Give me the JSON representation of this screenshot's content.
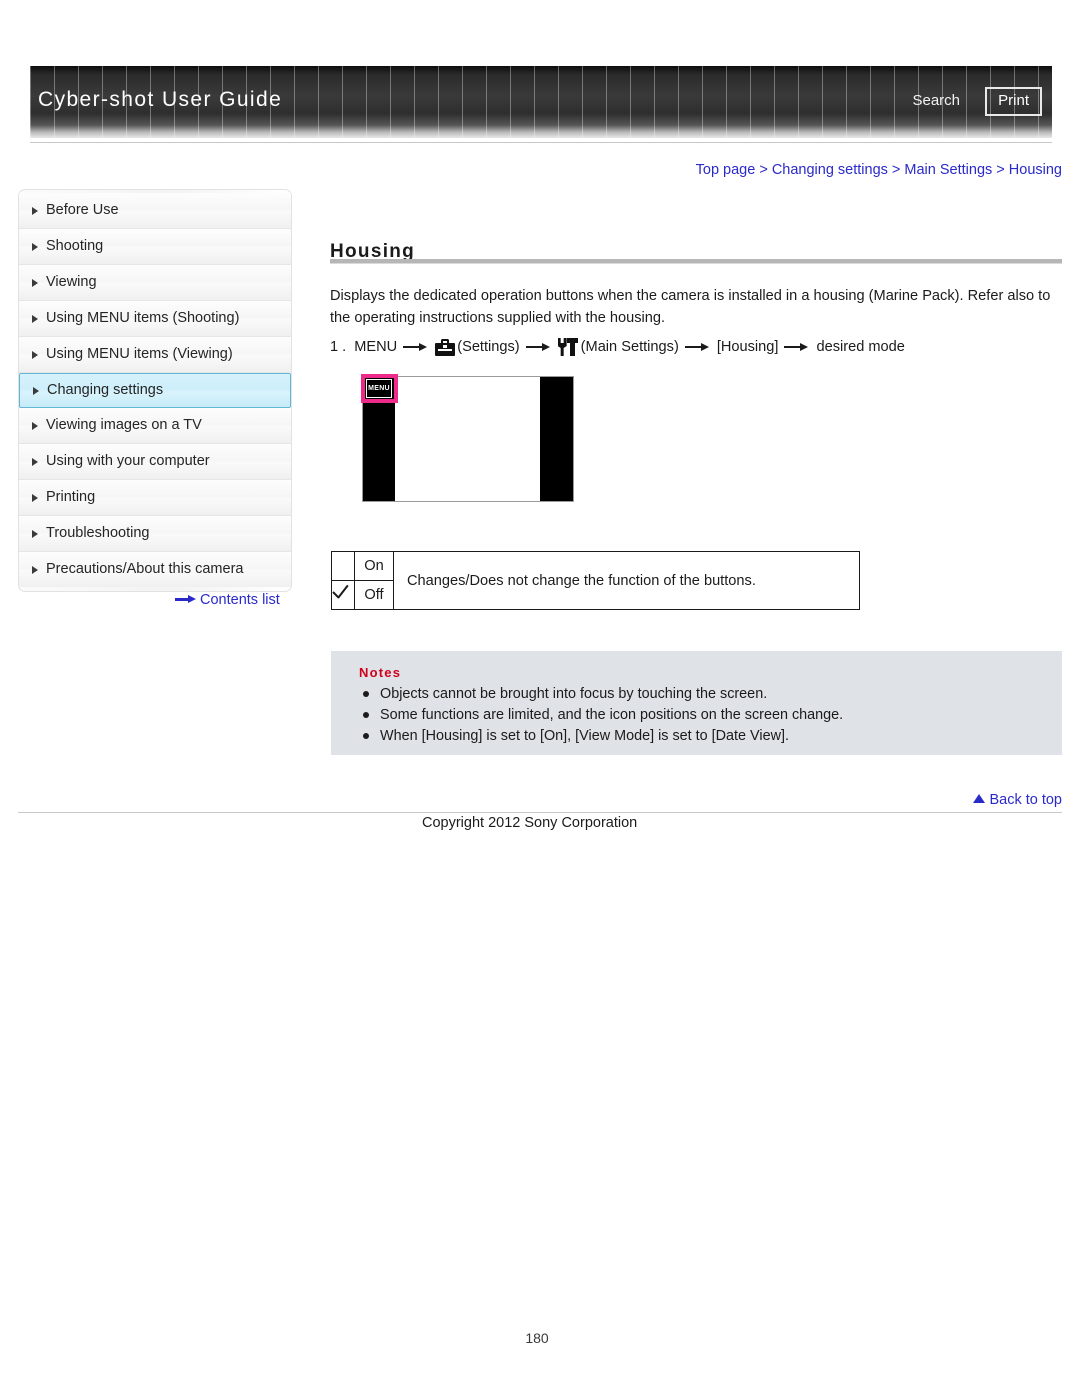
{
  "header": {
    "site_title": "Cyber-shot User Guide",
    "search_label": "Search",
    "print_label": "Print"
  },
  "sidebar": {
    "items": [
      {
        "label": "Before Use",
        "active": false
      },
      {
        "label": "Shooting",
        "active": false
      },
      {
        "label": "Viewing",
        "active": false
      },
      {
        "label": "Using MENU items (Shooting)",
        "active": false
      },
      {
        "label": "Using MENU items (Viewing)",
        "active": false
      },
      {
        "label": "Changing settings",
        "active": true
      },
      {
        "label": "Viewing images on a TV",
        "active": false
      },
      {
        "label": "Using with your computer",
        "active": false
      },
      {
        "label": "Printing",
        "active": false
      },
      {
        "label": "Troubleshooting",
        "active": false
      },
      {
        "label": "Precautions/About this camera",
        "active": false
      }
    ],
    "contents_list_label": "Contents list"
  },
  "main": {
    "breadcrumb": "Top page > Changing settings > Main Settings > Housing",
    "title": "Housing",
    "intro": "Displays the dedicated operation buttons when the camera is installed in a housing (Marine Pack). Refer also to the operating instructions supplied with the housing.",
    "step": {
      "number": "1 .",
      "menu": "MENU",
      "settings_label": "(Settings)",
      "main_settings_label": "(Main Settings)",
      "housing_label": "[Housing]",
      "desired_mode_label": "desired mode",
      "settings_icon": "toolbox-icon",
      "main_settings_icon": "tools-icon"
    },
    "illustration": {
      "menu_button_label": "MENU",
      "highlight_color": "#ee2a8b"
    },
    "table": {
      "rows": [
        {
          "checked": false,
          "label": "On"
        },
        {
          "checked": true,
          "label": "Off"
        }
      ],
      "description": "Changes/Does not change the function of the buttons."
    },
    "notes": {
      "heading": "Notes",
      "items": [
        "Objects cannot be brought into focus by touching the screen.",
        "Some functions are limited, and the icon positions on the screen change.",
        "When [Housing] is set to [On], [View Mode] is set to [Date View]."
      ]
    }
  },
  "footer": {
    "back_to_top_label": "Back to top",
    "copyright": "Copyright 2012 Sony Corporation",
    "page_number": "180"
  }
}
